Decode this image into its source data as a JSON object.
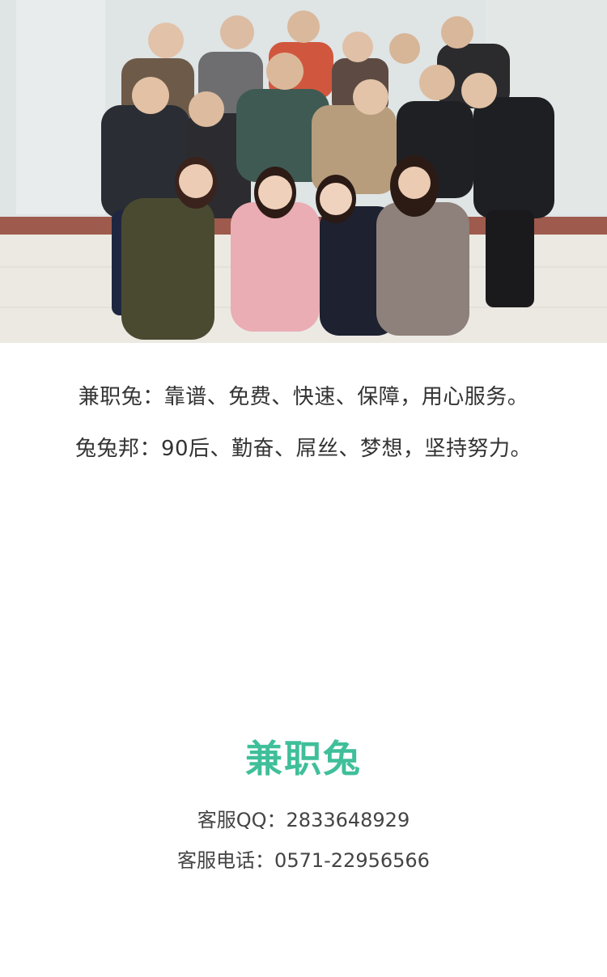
{
  "photo": {
    "icon": "team-group-photo"
  },
  "slogans": [
    "兼职兔：靠谱、免费、快速、保障，用心服务。",
    "兔兔邦：90后、勤奋、屌丝、梦想，坚持努力。"
  ],
  "brand": {
    "name": "兼职兔",
    "color": "#3fbf9a"
  },
  "contact": {
    "qq_label": "客服QQ：2833648929",
    "phone_label": "客服电话：0571-22956566"
  }
}
